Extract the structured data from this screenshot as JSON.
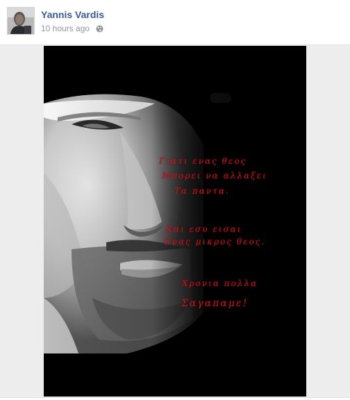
{
  "post": {
    "author": "Yannis Vardis",
    "timestamp": "10 hours ago",
    "privacy_icon": "globe-icon",
    "avatar_icon": "profile-photo"
  },
  "photo": {
    "poem_lines": [
      "Γιατι ενας θεος",
      "Μπορει να αλλαξει",
      "Τα παντα.",
      "Και εσυ εισαι",
      "Ενας μικρος θεος.",
      "Χρονια πολλα",
      "Σαγαπαμε!"
    ],
    "text_color": "#c0161c"
  },
  "colors": {
    "link_blue": "#3b5998",
    "meta_gray": "#90949c",
    "media_bg": "#ededed"
  }
}
